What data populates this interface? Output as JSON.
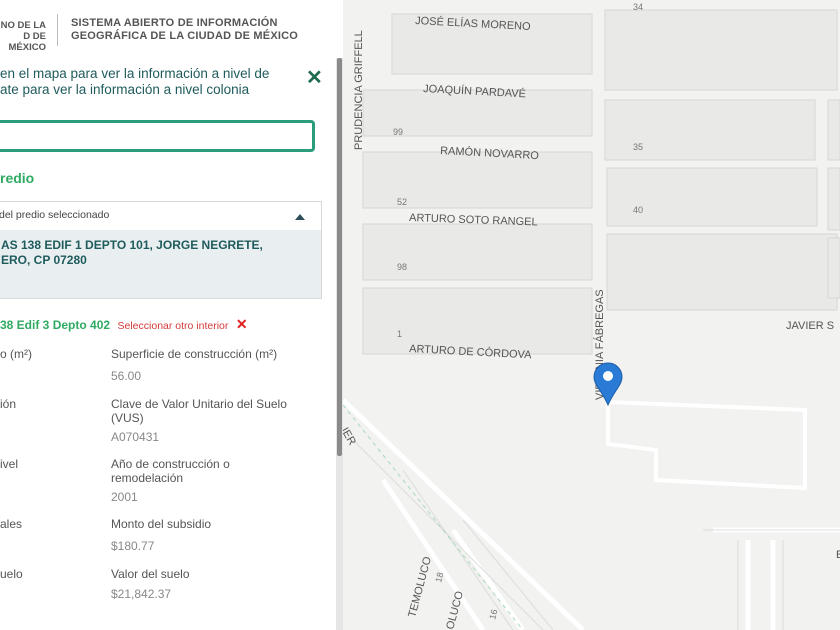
{
  "header": {
    "gov_logo_lines": [
      "NO DE LA",
      "D DE MÉXICO"
    ],
    "system_title_lines": [
      "SISTEMA ABIERTO DE INFORMACIÓN",
      "GEOGRÁFICA DE LA CIUDAD DE MÉXICO"
    ]
  },
  "panel": {
    "instruction_lines": [
      "en el mapa para ver la información a nivel de",
      "ate para ver la información a nivel colonia"
    ],
    "search": {
      "value": "",
      "placeholder": ""
    },
    "predio_heading": "redio",
    "accordion_title": "del predio seleccionado",
    "address_lines": [
      "AS 138 EDIF 1 DEPTO 101, JORGE NEGRETE,",
      "ERO, CP 07280"
    ],
    "interior": {
      "id": "38 Edif 3 Depto 402",
      "change_label": "Seleccionar otro interior",
      "clear_icon": "x-icon"
    },
    "fields": [
      {
        "label": "o (m²)",
        "value": ""
      },
      {
        "label": "Superficie de construcción (m²)",
        "value": "56.00"
      },
      {
        "label": "ión",
        "value": ""
      },
      {
        "label": "Clave de Valor Unitario del Suelo (VUS)",
        "value": "A070431"
      },
      {
        "label": "ivel",
        "value": ""
      },
      {
        "label": "Año de construcción o remodelación",
        "value": "2001"
      },
      {
        "label": "ales",
        "value": ""
      },
      {
        "label": "Monto del subsidio",
        "value": "$180.77"
      },
      {
        "label": "uelo",
        "value": ""
      },
      {
        "label": "Valor del suelo",
        "value": "$21,842.37"
      }
    ]
  },
  "map": {
    "streets": [
      "JOSÉ ELÍAS MORENO",
      "JOAQUÍN PARDAVÉ",
      "RAMÓN NOVARRO",
      "ARTURO SOTO RANGEL",
      "JAVIER S",
      "ARTURO DE CÓRDOVA",
      "PRUDENCIA GRIFFELL",
      "VIRGINIA FÁBREGAS",
      "IER",
      "TEMOLUCO",
      "OLUCO",
      "E"
    ],
    "lot_numbers": [
      "34",
      "99",
      "35",
      "52",
      "40",
      "98",
      "1",
      "18",
      "16"
    ],
    "marker_icon": "map-pin-icon"
  },
  "colors": {
    "accent": "#2a9d7d",
    "heading_green": "#2faa62",
    "link_red": "#d43a3a",
    "text_teal": "#1f5b5c",
    "marker": "#2a7bd6"
  }
}
